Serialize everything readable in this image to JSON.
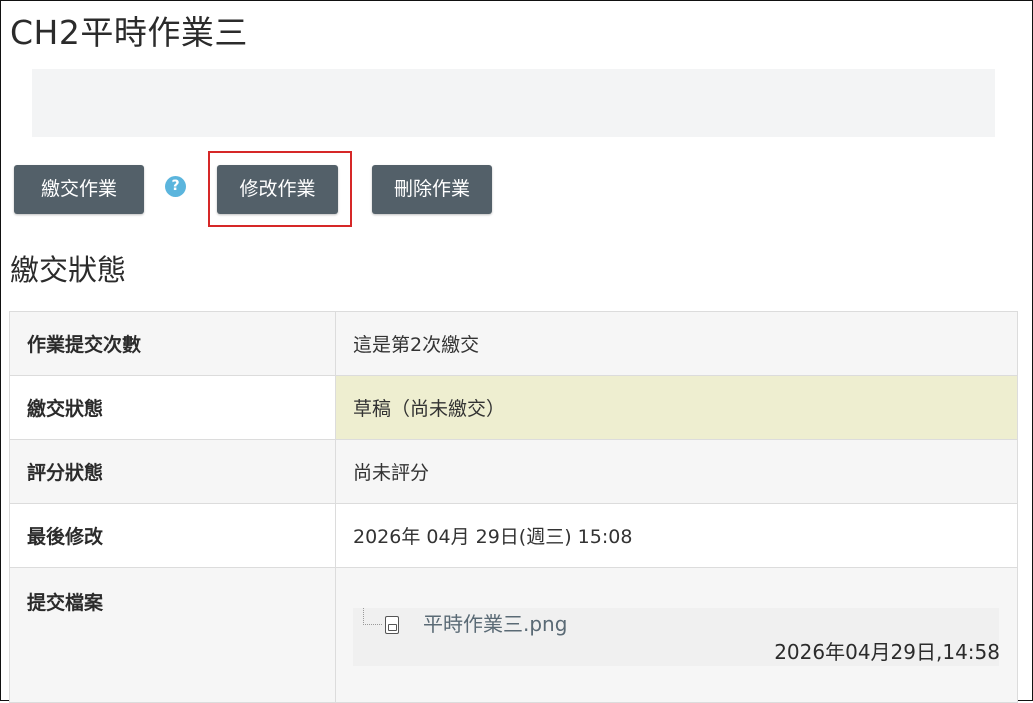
{
  "page": {
    "title": "CH2平時作業三",
    "help_icon": "?"
  },
  "actions": {
    "submit_label": "繳交作業",
    "edit_label": "修改作業",
    "delete_label": "刪除作業"
  },
  "submission": {
    "heading": "繳交狀態",
    "rows": [
      {
        "label": "作業提交次數",
        "value": "這是第2次繳交"
      },
      {
        "label": "繳交狀態",
        "value": "草稿（尚未繳交）"
      },
      {
        "label": "評分狀態",
        "value": "尚未評分"
      },
      {
        "label": "最後修改",
        "value": "2026年 04月 29日(週三) 15:08"
      }
    ],
    "files": {
      "label": "提交檔案",
      "file_name": "平時作業三.png",
      "file_icon": "image-file-icon",
      "file_time": "2026年04月29日,14:58"
    }
  },
  "colors": {
    "button_bg": "#536069",
    "draft_highlight": "#eeeed0",
    "help_icon_bg": "#5bb5dd",
    "annotation_border": "#d62828"
  }
}
